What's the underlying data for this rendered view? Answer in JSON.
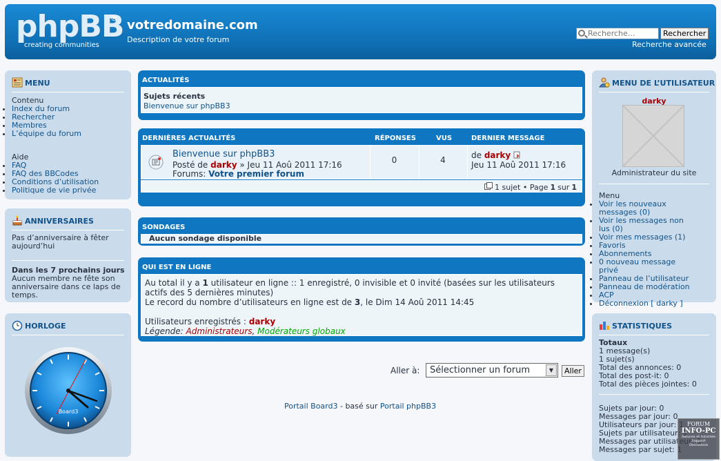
{
  "header": {
    "site_title": "votredomaine.com",
    "site_desc": "Description de votre forum",
    "logo_text": "phpBB",
    "logo_tagline": "creating communities",
    "search_placeholder": "Recherche…",
    "search_button": "Rechercher",
    "advanced_search": "Recherche avancée"
  },
  "menu": {
    "title": "MENU",
    "section1": "Contenu",
    "items1": [
      "Index du forum",
      "Rechercher",
      "Membres",
      "L’équipe du forum"
    ],
    "section2": "Aide",
    "items2": [
      "FAQ",
      "FAQ des BBCodes",
      "Conditions d’utilisation",
      "Politique de vie privée"
    ]
  },
  "birthdays": {
    "title": "ANNIVERSAIRES",
    "today": "Pas d’anniversaire à fêter aujourd’hui",
    "next_title": "Dans les 7 prochains jours",
    "next_text": "Aucun membre ne fête son anniversaire dans ce laps de temps."
  },
  "clock": {
    "title": "HORLOGE",
    "brand": "Board3"
  },
  "news": {
    "title": "ACTUALITÉS",
    "recent_label": "Sujets récents",
    "recent_topic": "Bienvenue sur phpBB3"
  },
  "latest": {
    "title": "DERNIÈRES ACTUALITÉS",
    "col_replies": "RÉPONSES",
    "col_views": "VUS",
    "col_last": "DERNIER MESSAGE",
    "topic_title": "Bienvenue sur phpBB3",
    "posted_by": "Posté de",
    "author": "darky",
    "posted_date": "» Jeu 11 Aoû 2011 17:16",
    "forum_label": "Forums:",
    "forum_name": "Votre premier forum",
    "replies": "0",
    "views": "4",
    "last_by": "de",
    "last_author": "darky",
    "last_date": "Jeu 11 Aoû 2011 17:16",
    "pagination_pre": "1 sujet • Page",
    "page_cur": "1",
    "page_sep": "sur",
    "page_total": "1"
  },
  "polls": {
    "title": "SONDAGES",
    "empty": "Aucun sondage disponible"
  },
  "online": {
    "title": "QUI EST EN LIGNE",
    "total_pre": "Au total il y a",
    "total_count": "1",
    "total_post": "utilisateur en ligne :: 1 enregistré, 0 invisible et 0 invité (basées sur les utilisateurs actifs des 5 dernières minutes)",
    "record_pre": "Le record du nombre d’utilisateurs en ligne est de",
    "record_count": "3",
    "record_post": ", le Dim 14 Aoû 2011 14:45",
    "registered_label": "Utilisateurs enregistrés :",
    "registered_user": "darky",
    "legend_label": "Légende:",
    "legend_admins": "Administrateurs",
    "legend_sep": ",",
    "legend_mods": "Modérateurs globaux"
  },
  "jump": {
    "label": "Aller à:",
    "select": "Sélectionner un forum",
    "button": "Aller"
  },
  "footer": {
    "left": "Portail Board3",
    "mid": " - basé sur ",
    "right": "Portail phpBB3"
  },
  "usermenu": {
    "title": "MENU DE L’UTILISATEUR",
    "username": "darky",
    "role": "Administrateur du site",
    "section": "Menu",
    "items": [
      "Voir les nouveaux messages (0)",
      "Voir les messages non lus (0)",
      "Voir mes messages (1)",
      "Favoris",
      "Abonnements",
      "0 nouveau message privé",
      "Panneau de l’utilisateur",
      "Panneau de modération",
      "ACP",
      "Déconnexion [ darky ]"
    ]
  },
  "stats": {
    "title": "STATISTIQUES",
    "totals_label": "Totaux",
    "lines1": [
      "1 message(s)",
      "1 sujet(s)",
      "Total des annonces: 0",
      "Total des post-it: 0",
      "Total des pièces jointes: 0"
    ],
    "lines2": [
      "Sujets par jour: 0",
      "Messages par jour: 0",
      "Utilisateurs par jour: 1",
      "Sujets par utilisateur: 1",
      "Messages par utilisateur: 1",
      "Messages par sujet: 1"
    ]
  },
  "watermark": {
    "line1": "FORUM",
    "line2": "INFO-PC",
    "line3": "Astuces et tutoriels",
    "line4": "Support",
    "line5": "Discussion"
  },
  "colors": {
    "header_blue": "#0f77c2",
    "panel": "#cadceb",
    "link": "#105289",
    "admin_red": "#aa0000",
    "mod_green": "#00aa00"
  }
}
